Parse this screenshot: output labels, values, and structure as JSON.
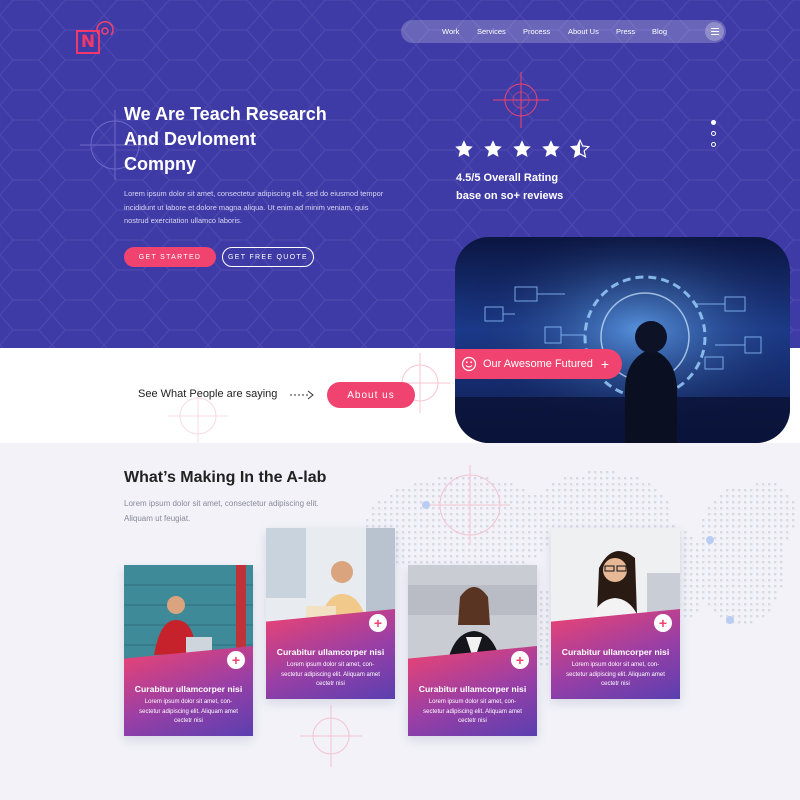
{
  "brand": {
    "logo_letter": "N"
  },
  "nav": {
    "items": [
      {
        "label": "Work"
      },
      {
        "label": "Services"
      },
      {
        "label": "Process"
      },
      {
        "label": "About Us"
      },
      {
        "label": "Press"
      },
      {
        "label": "Blog"
      }
    ]
  },
  "hero": {
    "title_line1": "We Are Teach Research",
    "title_line2": "And Devloment",
    "title_line3": "Compny",
    "description": "Lorem ipsum dolor sit amet, consectetur adipiscing elit, sed do eiusmod tempor incididunt ut labore et dolore magna aliqua. Ut enim ad minim veniam, quis nostrud exercitation ullamco laboris.",
    "btn_start": "GET STARTED",
    "btn_quote": "GET FREE QUOTE",
    "rating_value": 4.5,
    "rating_max": 5,
    "rating_line1": "4.5/5 Overall Rating",
    "rating_line2": "base on so+ reviews",
    "slider_active_dot": 1,
    "slider_dot_count": 3
  },
  "feature": {
    "pill_label": "Our Awesome Futured",
    "pill_icon": "smile-icon",
    "pill_plus": "+"
  },
  "band": {
    "say_text": "See What People are saying",
    "about_btn": "About us"
  },
  "section": {
    "title": "What’s Making In the A-lab",
    "description": "Lorem ipsum dolor sit amet, consectetur adipiscing elit. Aliquam ut feugiat."
  },
  "cards": [
    {
      "title": "Curabitur ullamcorper nisi",
      "text": "Lorem ipsum dolor sit amet, con- sectetur adipiscing elit. Aliquam amet cectetr nisi",
      "plus": "+"
    },
    {
      "title": "Curabitur ullamcorper nisi",
      "text": "Lorem ipsum dolor sit amet, con- sectetur adipiscing elit. Aliquam amet cectetr nisi",
      "plus": "+"
    },
    {
      "title": "Curabitur ullamcorper nisi",
      "text": "Lorem ipsum dolor sit amet, con- sectetur adipiscing elit. Aliquam amet cectetr nisi",
      "plus": "+"
    },
    {
      "title": "Curabitur ullamcorper nisi",
      "text": "Lorem ipsum dolor sit amet, con- sectetur adipiscing elit. Aliquam amet cectetr nisi",
      "plus": "+"
    }
  ],
  "colors": {
    "hero_bg": "#3f3ba6",
    "accent": "#f0436f",
    "card_gradient_start": "#f0436f",
    "card_gradient_end": "#5a3fb0"
  }
}
